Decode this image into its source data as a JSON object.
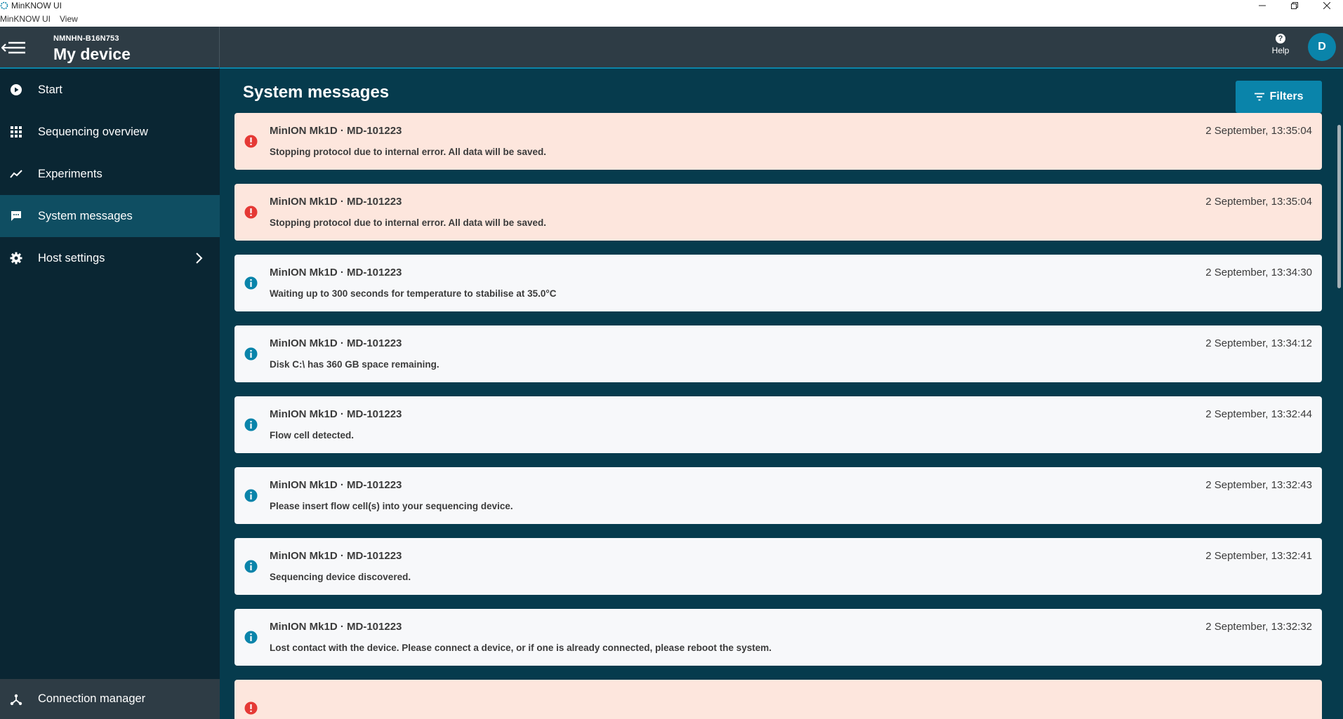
{
  "window": {
    "title": "MinKNOW UI",
    "menu": [
      "MinKNOW UI",
      "View"
    ]
  },
  "header": {
    "device_id": "NMNHN-B16N753",
    "device_title": "My device",
    "help_label": "Help",
    "avatar_initial": "D"
  },
  "sidebar": {
    "items": [
      {
        "label": "Start",
        "icon": "play-circle-icon"
      },
      {
        "label": "Sequencing overview",
        "icon": "grid-icon"
      },
      {
        "label": "Experiments",
        "icon": "trend-line-icon"
      },
      {
        "label": "System messages",
        "icon": "chat-bubble-icon"
      },
      {
        "label": "Host settings",
        "icon": "gear-icon"
      }
    ],
    "active_index": 3,
    "footer_label": "Connection manager"
  },
  "main": {
    "title": "System messages",
    "filters_label": "Filters",
    "messages": [
      {
        "level": "error",
        "device": "MinION Mk1D · MD-101223",
        "text": "Stopping protocol due to internal error. All data will be saved.",
        "time": "2 September, 13:35:04"
      },
      {
        "level": "error",
        "device": "MinION Mk1D · MD-101223",
        "text": "Stopping protocol due to internal error. All data will be saved.",
        "time": "2 September, 13:35:04"
      },
      {
        "level": "info",
        "device": "MinION Mk1D · MD-101223",
        "text": "Waiting up to 300 seconds for temperature to stabilise at 35.0°C",
        "time": "2 September, 13:34:30"
      },
      {
        "level": "info",
        "device": "MinION Mk1D · MD-101223",
        "text": "Disk C:\\ has 360 GB space remaining.",
        "time": "2 September, 13:34:12"
      },
      {
        "level": "info",
        "device": "MinION Mk1D · MD-101223",
        "text": "Flow cell detected.",
        "time": "2 September, 13:32:44"
      },
      {
        "level": "info",
        "device": "MinION Mk1D · MD-101223",
        "text": "Please insert flow cell(s) into your sequencing device.",
        "time": "2 September, 13:32:43"
      },
      {
        "level": "info",
        "device": "MinION Mk1D · MD-101223",
        "text": "Sequencing device discovered.",
        "time": "2 September, 13:32:41"
      },
      {
        "level": "info",
        "device": "MinION Mk1D · MD-101223",
        "text": "Lost contact with the device. Please connect a device, or if one is already connected, please reboot the system.",
        "time": "2 September, 13:32:32"
      },
      {
        "level": "error",
        "device": "",
        "text": "",
        "time": ""
      }
    ]
  },
  "colors": {
    "accent": "#0a84aa",
    "error_bg": "#fde6dd",
    "error_icon": "#e53935",
    "info_icon": "#0a84aa",
    "sidebar_bg": "#0a2633",
    "main_bg": "#063b4d"
  }
}
